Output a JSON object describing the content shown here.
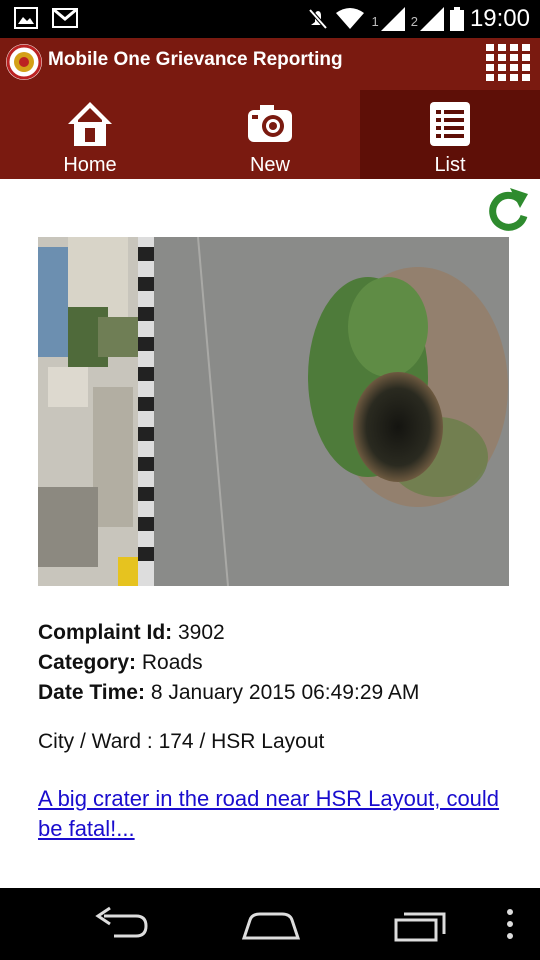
{
  "status_bar": {
    "time": "19:00",
    "sim1": "1",
    "sim2": "2",
    "icons": [
      "image-icon",
      "gmail-icon",
      "mute-icon",
      "wifi-icon",
      "signal-icon",
      "signal-icon",
      "battery-icon"
    ]
  },
  "app": {
    "title": "Mobile One Grievance Reporting",
    "theme_color": "#7a1a10",
    "active_tab_color": "#5e0f07"
  },
  "tabs": [
    {
      "label": "Home",
      "icon": "home-icon",
      "active": false
    },
    {
      "label": "New",
      "icon": "camera-icon",
      "active": false
    },
    {
      "label": "List",
      "icon": "list-icon",
      "active": true
    }
  ],
  "complaint": {
    "id_label": "Complaint Id:",
    "id_value": "3902",
    "category_label": "Category:",
    "category_value": "Roads",
    "datetime_label": "Date Time:",
    "datetime_value": "8 January 2015 06:49:29 AM",
    "city_ward": "City / Ward : 174 / HSR Layout",
    "description": "A big crater in the road near HSR Layout, could be fatal!..."
  }
}
